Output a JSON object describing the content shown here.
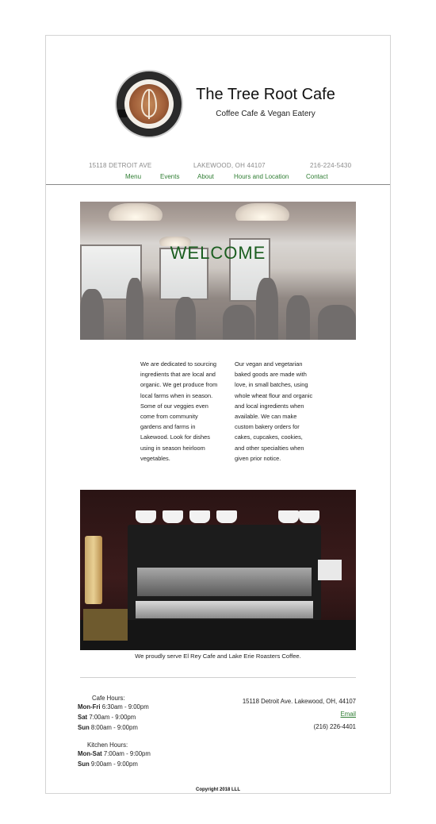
{
  "header": {
    "title": "The Tree Root Cafe",
    "subtitle": "Coffee Cafe & Vegan Eatery",
    "logo_icon": "latte-art-logo-icon"
  },
  "info": {
    "address": "15118 DETROIT AVE",
    "city": "LAKEWOOD, OH 44107",
    "phone": "216-224-5430"
  },
  "nav": {
    "items": [
      {
        "label": "Menu"
      },
      {
        "label": "Events"
      },
      {
        "label": "About"
      },
      {
        "label": "Hours and Location"
      },
      {
        "label": "Contact"
      }
    ]
  },
  "hero": {
    "heading": "WELCOME"
  },
  "body": {
    "col1": "We are dedicated to sourcing ingredients that are local and organic. We get produce from local farms when in season. Some of our veggies even come from community gardens and farms in Lakewood. Look for dishes using in season heirloom vegetables.",
    "col2": "Our vegan and vegetarian baked goods are made with love, in small batches, using whole wheat flour and organic and local ingredients when available. We can make custom bakery orders for cakes, cupcakes, cookies, and other specialties when given prior notice."
  },
  "espresso": {
    "caption": "We proudly serve El Rey Cafe and Lake Erie Roasters Coffee."
  },
  "footer": {
    "cafe_hours_title": "Cafe Hours:",
    "cafe_hours": [
      {
        "day": "Mon-Fri",
        "time": "6:30am - 9:00pm"
      },
      {
        "day": "Sat",
        "time": "7:00am - 9:00pm"
      },
      {
        "day": "Sun",
        "time": "8:00am - 9:00pm"
      }
    ],
    "kitchen_hours_title": "Kitchen Hours:",
    "kitchen_hours": [
      {
        "day": "Mon-Sat",
        "time": "7:00am - 9:00pm"
      },
      {
        "day": "Sun",
        "time": "9:00am - 9:00pm"
      }
    ],
    "address": "15118 Detroit Ave. Lakewood, OH, 44107",
    "email_label": "Email",
    "phone": "(216) 226-4401",
    "copyright": "Copyright 2018 LLL"
  },
  "colors": {
    "accent": "#2e7d32",
    "welcome": "#1b5e20",
    "muted": "#8a8a8a"
  }
}
